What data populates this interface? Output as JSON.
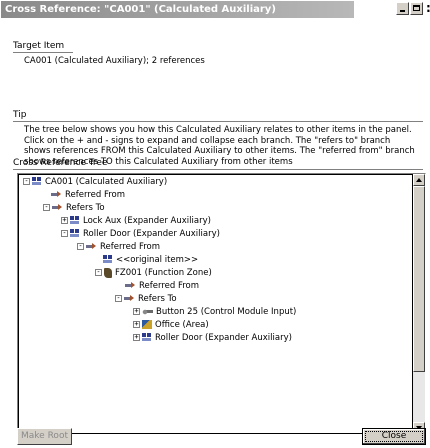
{
  "window": {
    "title": "Cross Reference: \"CA001\" (Calculated Auxiliary)",
    "close_glyph": ":"
  },
  "target_item": {
    "label": "Target Item",
    "value": "CA001 (Calculated Auxiliary); 2 references"
  },
  "tip": {
    "label": "Tip",
    "text": "The tree below shows you how this Calculated Auxiliary relates to other items in the panel. Click on the + and - signs to expand and collapse each branch. The \"refers to\" branch shows references FROM this Calculated Auxiliary to other items. The \"referred from\" branch shows references TO this Calculated Auxiliary from other items"
  },
  "tree_section": {
    "label": "Cross Reference Tree",
    "nodes": [
      {
        "expander": "-",
        "icon": "variable-icon",
        "label": "CA001 (Calculated Auxiliary)"
      },
      {
        "expander": "",
        "icon": "reference-arrow-icon",
        "label": "Referred From"
      },
      {
        "expander": "-",
        "icon": "reference-arrow-icon",
        "label": "Refers To"
      },
      {
        "expander": "+",
        "icon": "variable-icon",
        "label": "Lock Aux (Expander Auxiliary)"
      },
      {
        "expander": "-",
        "icon": "variable-icon",
        "label": "Roller Door (Expander Auxiliary)"
      },
      {
        "expander": "-",
        "icon": "reference-arrow-icon",
        "label": "Referred From"
      },
      {
        "expander": "",
        "icon": "variable-icon",
        "label": "<<original item>>"
      },
      {
        "expander": "-",
        "icon": "zone-icon",
        "label": "FZ001 (Function Zone)"
      },
      {
        "expander": "",
        "icon": "reference-arrow-icon",
        "label": "Referred From"
      },
      {
        "expander": "-",
        "icon": "reference-arrow-icon",
        "label": "Refers To"
      },
      {
        "expander": "+",
        "icon": "module-icon",
        "label": "Button 25 (Control Module Input)"
      },
      {
        "expander": "+",
        "icon": "office-icon",
        "label": "Office (Area)"
      },
      {
        "expander": "+",
        "icon": "variable-icon",
        "label": "Roller Door (Expander Auxiliary)"
      }
    ]
  },
  "buttons": {
    "make_root": "Make Root",
    "close": "Close"
  }
}
